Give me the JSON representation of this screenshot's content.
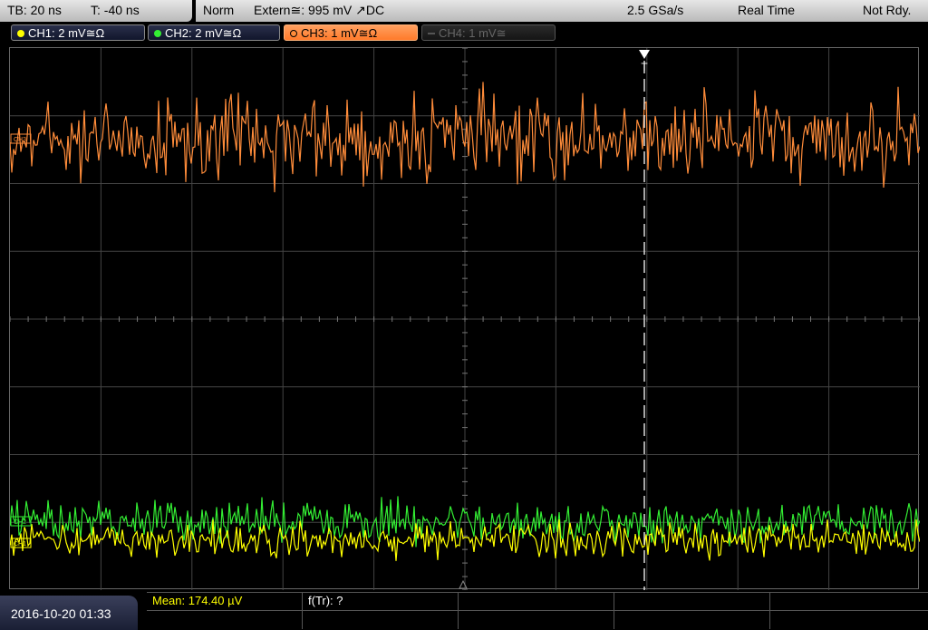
{
  "topbar": {
    "timebase": "TB: 20 ns",
    "trigger_pos": "T: -40 ns",
    "mode": "Norm",
    "trigger_source": "Extern≅: 995 mV ↗DC",
    "sample_rate": "2.5 GSa/s",
    "acq_mode": "Real Time",
    "status": "Not Rdy."
  },
  "channels": [
    {
      "label": "CH1: 2 mV≅Ω",
      "color": "#ffff00",
      "state": "on"
    },
    {
      "label": "CH2: 2 mV≅Ω",
      "color": "#33ee33",
      "state": "on"
    },
    {
      "label": "CH3: 1 mV≅Ω",
      "color": "#ff8c3a",
      "state": "active"
    },
    {
      "label": "CH4: 1 mV≅",
      "color": "#777777",
      "state": "off"
    }
  ],
  "markers": {
    "ch3": "CH3",
    "ch2": "CH2",
    "ch1": "CH1",
    "trigger": "T"
  },
  "bottom": {
    "datetime": "2016-10-20 01:33",
    "measurements": [
      {
        "label": "Mean: 174.40 µV",
        "color": "#ffff00"
      },
      {
        "label": "f(Tr): ?",
        "color": "#ffffff"
      }
    ]
  },
  "colors": {
    "ch1": "#ffff00",
    "ch2": "#33ee33",
    "ch3": "#ff8c3a",
    "grid": "#444444"
  }
}
